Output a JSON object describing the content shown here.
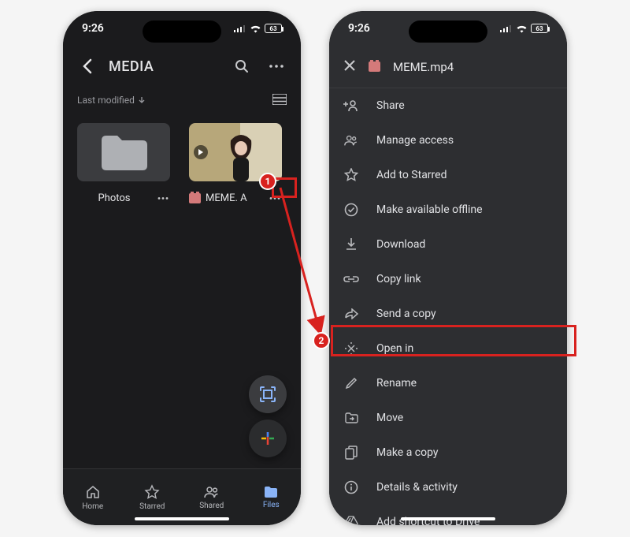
{
  "status": {
    "time": "9:26",
    "battery": "63"
  },
  "left": {
    "title": "MEDIA",
    "sort_label": "Last modified",
    "items": {
      "folder": {
        "label": "Photos"
      },
      "video": {
        "label": "MEME. A"
      }
    },
    "nav": {
      "home": "Home",
      "starred": "Starred",
      "shared": "Shared",
      "files": "Files"
    }
  },
  "right": {
    "filename": "MEME.mp4",
    "menu": {
      "share": "Share",
      "manage_access": "Manage access",
      "add_starred": "Add to Starred",
      "offline": "Make available offline",
      "download": "Download",
      "copy_link": "Copy link",
      "send_copy": "Send a copy",
      "open_in": "Open in",
      "rename": "Rename",
      "move": "Move",
      "make_copy": "Make a copy",
      "details": "Details & activity",
      "shortcut": "Add shortcut to Drive"
    }
  },
  "callouts": {
    "one": "1",
    "two": "2"
  }
}
